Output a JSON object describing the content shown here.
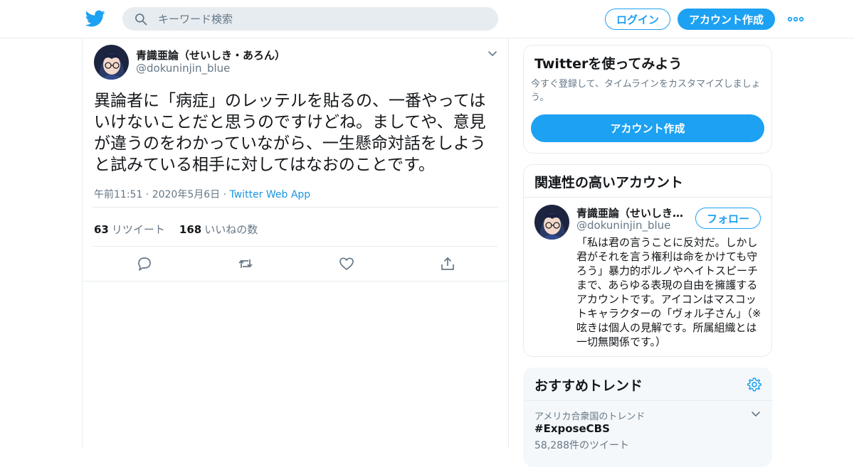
{
  "header": {
    "logo_icon": "twitter-bird-icon",
    "search_placeholder": "キーワード検索",
    "login_label": "ログイン",
    "signup_label": "アカウント作成",
    "brand_color": "#1da1f2"
  },
  "tweet": {
    "name": "青識亜論（せいしき・あろん）",
    "handle": "@dokuninjin_blue",
    "text": "異論者に「病症」のレッテルを貼るの、一番やってはいけないことだと思うのですけどね。ましてや、意見が違うのをわかっていながら、一生懸命対話をしようと試みている相手に対してはなおのことです。",
    "timestamp": "午前11:51 · 2020年5月6日",
    "source": "Twitter Web App",
    "retweets_count": "63",
    "retweets_label": "リツイート",
    "likes_count": "168",
    "likes_label": "いいねの数"
  },
  "signup_card": {
    "title": "Twitterを使ってみよう",
    "description": "今すぐ登録して、タイムラインをカスタマイズしましょう。",
    "button": "アカウント作成"
  },
  "related": {
    "title": "関連性の高いアカウント",
    "name": "青識亜論（せいしき・あろん）",
    "handle": "@dokuninjin_blue",
    "follow_label": "フォロー",
    "bio": "「私は君の言うことに反対だ。しかし君がそれを言う権利は命をかけても守ろう」暴力的ポルノやヘイトスピーチまで、あらゆる表現の自由を擁護するアカウントです。アイコンはマスコットキャラクターの「ヴォル子さん」（※呟きは個人の見解です。所属組織とは一切無関係です。）"
  },
  "trends": {
    "title": "おすすめトレンド",
    "context": "アメリカ合衆国のトレンド",
    "trend": "#ExposeCBS",
    "count": "58,288件のツイート"
  }
}
